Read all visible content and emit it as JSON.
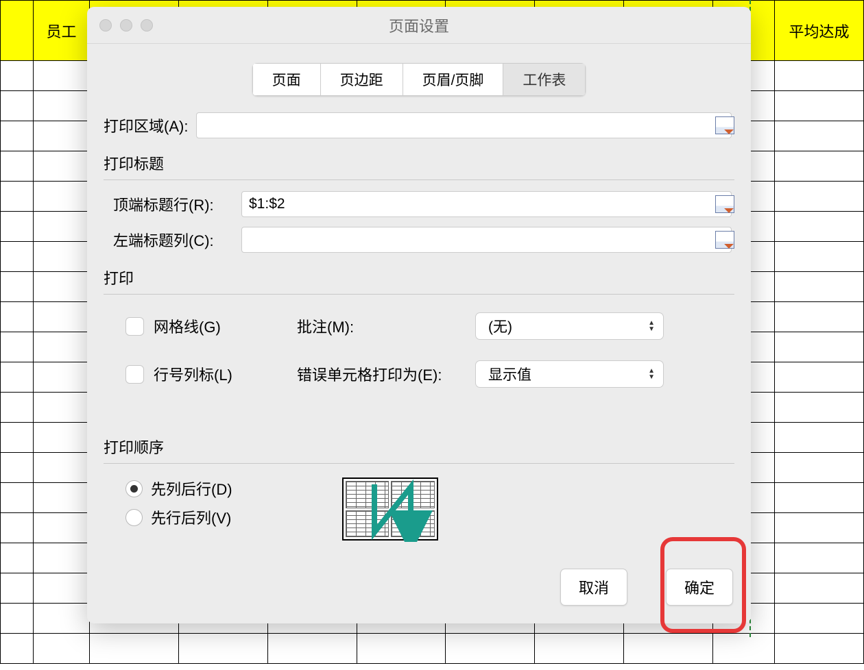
{
  "spreadsheet": {
    "header_left": "员工",
    "header_right": "平均达成"
  },
  "dialog": {
    "title": "页面设置",
    "tabs": {
      "page": "页面",
      "margins": "页边距",
      "header_footer": "页眉/页脚",
      "sheet": "工作表"
    },
    "print_area": {
      "label": "打印区域(A):",
      "value": ""
    },
    "print_titles": {
      "section": "打印标题",
      "rows_label": "顶端标题行(R):",
      "rows_value": "$1:$2",
      "cols_label": "左端标题列(C):",
      "cols_value": ""
    },
    "print": {
      "section": "打印",
      "gridlines": "网格线(G)",
      "row_col_headers": "行号列标(L)",
      "comments_label": "批注(M):",
      "comments_value": "(无)",
      "errors_label": "错误单元格打印为(E):",
      "errors_value": "显示值"
    },
    "page_order": {
      "section": "打印顺序",
      "down_then_over": "先列后行(D)",
      "over_then_down": "先行后列(V)"
    },
    "buttons": {
      "cancel": "取消",
      "ok": "确定"
    }
  }
}
